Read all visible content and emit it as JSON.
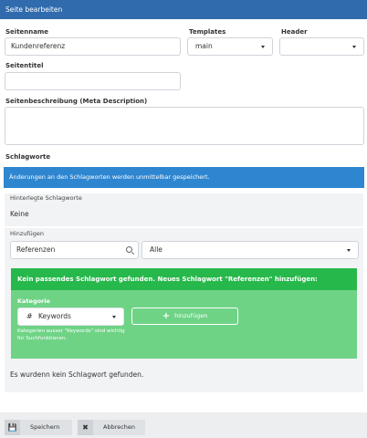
{
  "title": "Seite bearbeiten",
  "form": {
    "seitenname_label": "Seitenname",
    "seitenname_value": "Kundenreferenz",
    "templates_label": "Templates",
    "templates_value": "main",
    "header_label": "Header",
    "header_value": "",
    "seitentitel_label": "Seitentitel",
    "seitentitel_value": "",
    "description_label": "Seitenbeschreibung (Meta Description)",
    "description_value": ""
  },
  "keywords": {
    "section_label": "Schlagworte",
    "info": "Änderungen an den Schlagworten werden unmittelbar gespeichert.",
    "stored_label": "Hinterlegte Schlagworte",
    "stored_value": "Keine",
    "add_label": "Hinzufügen",
    "search_value": "Referenzen",
    "filter_value": "Alle",
    "not_found_header": "Kein passendes Schlagwort gefunden. Neues Schlagwort \"Referenzen\" hinzufügen:",
    "category_label": "Kategorie",
    "category_value": "Keywords",
    "category_icon": "#",
    "add_button": "hinzufügen",
    "hint": "Kategorien ausser \"Keywords\" sind wichtig für Suchfunktionen.",
    "none_found": "Es wurdenn kein Schlagwort gefunden."
  },
  "footer": {
    "save_label": "Speichern",
    "cancel_label": "Abbrechen"
  },
  "colors": {
    "titlebar": "#2f6bad",
    "info": "#2f86d0",
    "green_dark": "#27b84b",
    "green_light": "#6fd386"
  }
}
